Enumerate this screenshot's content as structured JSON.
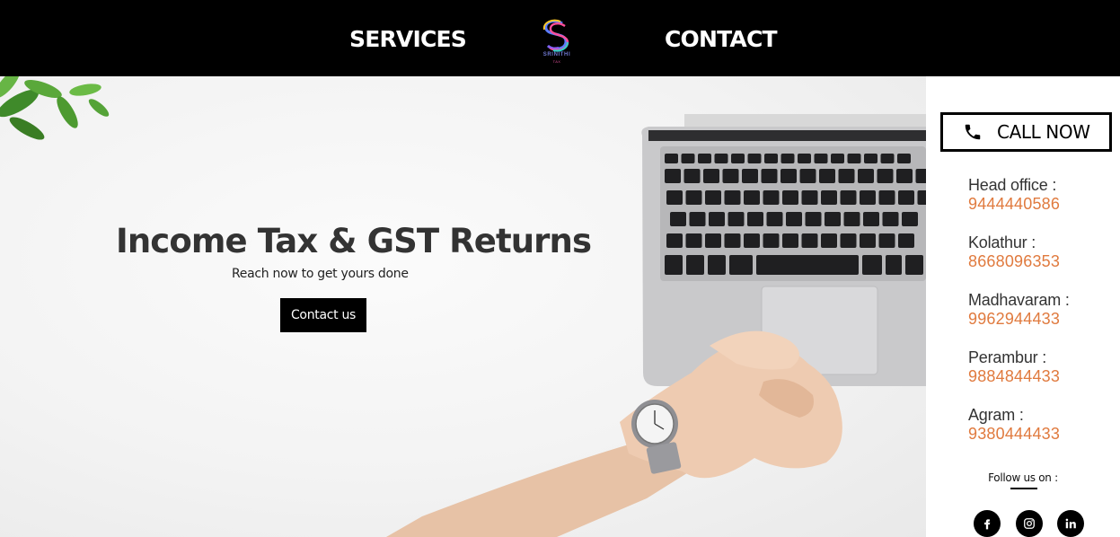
{
  "nav": {
    "services_label": "SERVICES",
    "contact_label": "CONTACT",
    "logo_name": "SRINITHI",
    "logo_sub": "TAX"
  },
  "hero": {
    "title": "Income Tax & GST Returns",
    "subtitle": "Reach now to get yours done",
    "button_label": "Contact us"
  },
  "sidebar": {
    "call_label": "CALL NOW",
    "offices": [
      {
        "name": "Head office :",
        "phone": "9444440586"
      },
      {
        "name": "Kolathur :",
        "phone": "8668096353"
      },
      {
        "name": "Madhavaram :",
        "phone": "9962944433"
      },
      {
        "name": "Perambur :",
        "phone": "9884844433"
      },
      {
        "name": "Agram :",
        "phone": "9380444433"
      }
    ],
    "follow_label": "Follow us on :",
    "socials": [
      "facebook-icon",
      "instagram-icon",
      "linkedin-icon"
    ]
  },
  "colors": {
    "nav_background": "#000000",
    "phone_accent": "#e07a3e",
    "button_background": "#000000"
  }
}
